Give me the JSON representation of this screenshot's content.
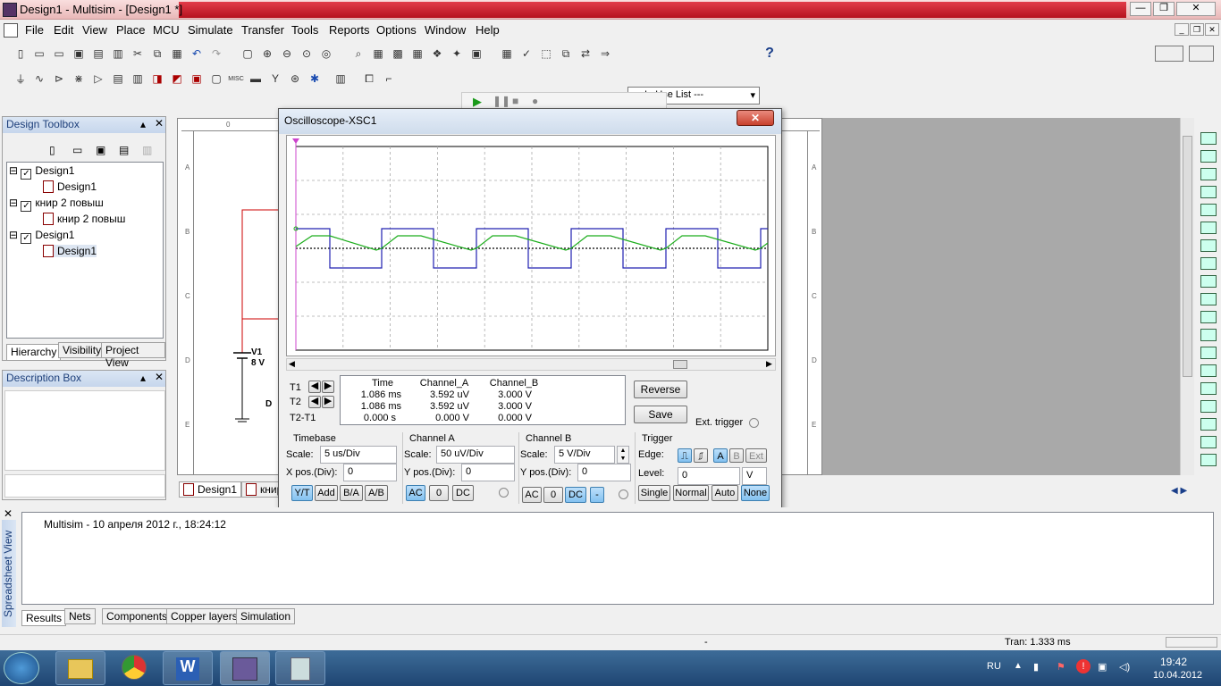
{
  "window": {
    "title": "Design1 - Multisim - [Design1 *]"
  },
  "menu": [
    "File",
    "Edit",
    "View",
    "Place",
    "MCU",
    "Simulate",
    "Transfer",
    "Tools",
    "Reports",
    "Options",
    "Window",
    "Help"
  ],
  "toolbar": {
    "in_use_list": "--- In Use List ---",
    "help": "?"
  },
  "design_toolbox": {
    "title": "Design Toolbox",
    "items": [
      "Design1",
      "Design1",
      "книр 2 повыш",
      "книр 2 повыш",
      "Design1",
      "Design1"
    ],
    "tabs": [
      "Hierarchy",
      "Visibility",
      "Project View"
    ]
  },
  "description_box": {
    "title": "Description Box"
  },
  "schematic": {
    "v1_name": "V1",
    "v1_value": "8 V",
    "diode": "D",
    "ruler_0": "0",
    "rows": [
      "A",
      "B",
      "C",
      "D",
      "E"
    ],
    "tabs": [
      "Design1",
      "книр"
    ]
  },
  "oscilloscope": {
    "title": "Oscilloscope-XSC1",
    "close": "✕",
    "cursors": {
      "t1": "T1",
      "t2": "T2",
      "t2t1": "T2-T1"
    },
    "table": {
      "headers": [
        "Time",
        "Channel_A",
        "Channel_B"
      ],
      "rows": [
        [
          "1.086 ms",
          "3.592 uV",
          "3.000 V"
        ],
        [
          "1.086 ms",
          "3.592 uV",
          "3.000 V"
        ],
        [
          "0.000 s",
          "0.000 V",
          "0.000 V"
        ]
      ]
    },
    "buttons": {
      "reverse": "Reverse",
      "save": "Save",
      "ext_trigger": "Ext. trigger"
    },
    "timebase": {
      "title": "Timebase",
      "scale_label": "Scale:",
      "scale": "5 us/Div",
      "xpos_label": "X pos.(Div):",
      "xpos": "0",
      "modes": [
        "Y/T",
        "Add",
        "B/A",
        "A/B"
      ]
    },
    "channel_a": {
      "title": "Channel A",
      "scale_label": "Scale:",
      "scale": "50 uV/Div",
      "ypos_label": "Y pos.(Div):",
      "ypos": "0",
      "coupling": [
        "AC",
        "0",
        "DC"
      ]
    },
    "channel_b": {
      "title": "Channel B",
      "scale_label": "Scale:",
      "scale": "5  V/Div",
      "ypos_label": "Y pos.(Div):",
      "ypos": "0",
      "coupling": [
        "AC",
        "0",
        "DC",
        "-"
      ]
    },
    "trigger": {
      "title": "Trigger",
      "edge_label": "Edge:",
      "level_label": "Level:",
      "level": "0",
      "level_unit": "V",
      "sources": [
        "A",
        "B",
        "Ext"
      ],
      "modes": [
        "Single",
        "Normal",
        "Auto",
        "None"
      ]
    },
    "colors": {
      "channel_a": "#1cad1c",
      "channel_b": "#2020b0",
      "t1": "#cc44cc"
    }
  },
  "spreadsheet": {
    "side_label": "Spreadsheet View",
    "message": "Multisim  -  10 апреля 2012 г., 18:24:12",
    "tabs": [
      "Results",
      "Nets",
      "Components",
      "Copper layers",
      "Simulation"
    ]
  },
  "status": {
    "dash": "-",
    "tran": "Tran: 1.333 ms"
  },
  "taskbar": {
    "lang": "RU",
    "time": "19:42",
    "date": "10.04.2012"
  }
}
